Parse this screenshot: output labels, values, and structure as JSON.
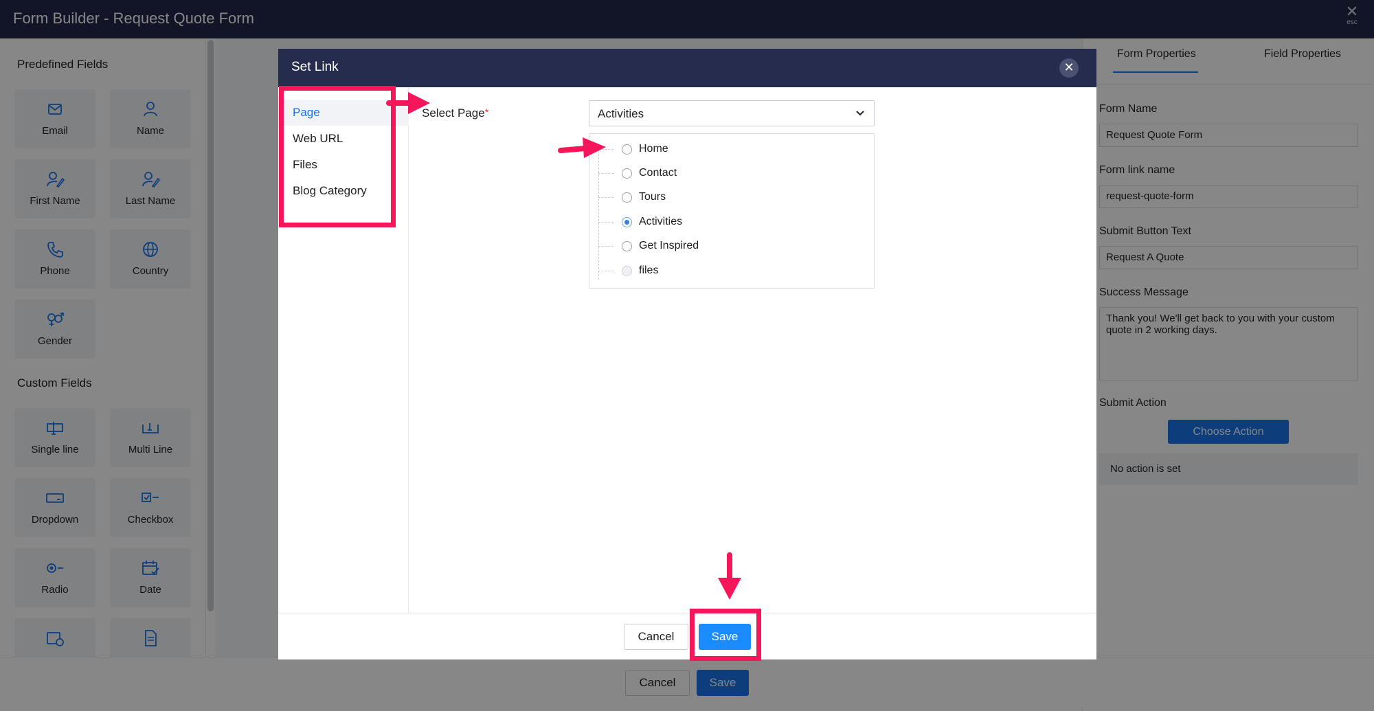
{
  "app": {
    "title": "Form Builder - Request Quote Form",
    "esc_icon": "close-icon",
    "esc_label": "esc"
  },
  "left_panel": {
    "predefined_title": "Predefined Fields",
    "predefined_fields": [
      {
        "label": "Email",
        "icon": "envelope-icon"
      },
      {
        "label": "Name",
        "icon": "person-icon"
      },
      {
        "label": "First Name",
        "icon": "person-edit-icon"
      },
      {
        "label": "Last Name",
        "icon": "person-edit-icon"
      },
      {
        "label": "Phone",
        "icon": "phone-icon"
      },
      {
        "label": "Country",
        "icon": "globe-icon"
      },
      {
        "label": "Gender",
        "icon": "gender-icon"
      }
    ],
    "custom_title": "Custom Fields",
    "custom_fields": [
      {
        "label": "Single line",
        "icon": "single-line-icon"
      },
      {
        "label": "Multi Line",
        "icon": "multi-line-icon"
      },
      {
        "label": "Dropdown",
        "icon": "dropdown-icon"
      },
      {
        "label": "Checkbox",
        "icon": "checkbox-icon"
      },
      {
        "label": "Radio",
        "icon": "radio-icon"
      },
      {
        "label": "Date",
        "icon": "calendar-icon"
      }
    ]
  },
  "right_panel": {
    "tabs": [
      "Form Properties",
      "Field Properties"
    ],
    "form_name_label": "Form Name",
    "form_name_value": "Request Quote Form",
    "form_link_label": "Form link name",
    "form_link_value": "request-quote-form",
    "submit_text_label": "Submit Button Text",
    "submit_text_value": "Request A Quote",
    "success_label": "Success Message",
    "success_value": "Thank you! We'll get back to you with your custom quote in 2 working days.",
    "submit_action_label": "Submit Action",
    "choose_action_label": "Choose Action",
    "no_action_text": "No action is set"
  },
  "bottom_bar": {
    "cancel_label": "Cancel",
    "save_label": "Save"
  },
  "modal": {
    "title": "Set Link",
    "side_items": [
      "Page",
      "Web URL",
      "Files",
      "Blog Category"
    ],
    "active_side_item": "Page",
    "select_label": "Select Page",
    "required_mark": "*",
    "selected_page": "Activities",
    "pages": [
      {
        "label": "Home",
        "checked": false,
        "disabled": false
      },
      {
        "label": "Contact",
        "checked": false,
        "disabled": false
      },
      {
        "label": "Tours",
        "checked": false,
        "disabled": false
      },
      {
        "label": "Activities",
        "checked": true,
        "disabled": false
      },
      {
        "label": "Get Inspired",
        "checked": false,
        "disabled": false
      },
      {
        "label": "files",
        "checked": false,
        "disabled": true
      }
    ],
    "cancel_label": "Cancel",
    "save_label": "Save"
  },
  "colors": {
    "header_navy": "#262c4d",
    "accent_blue": "#1a73e8",
    "save_blue": "#1a8cff",
    "annotation_pink": "#f5175a"
  }
}
